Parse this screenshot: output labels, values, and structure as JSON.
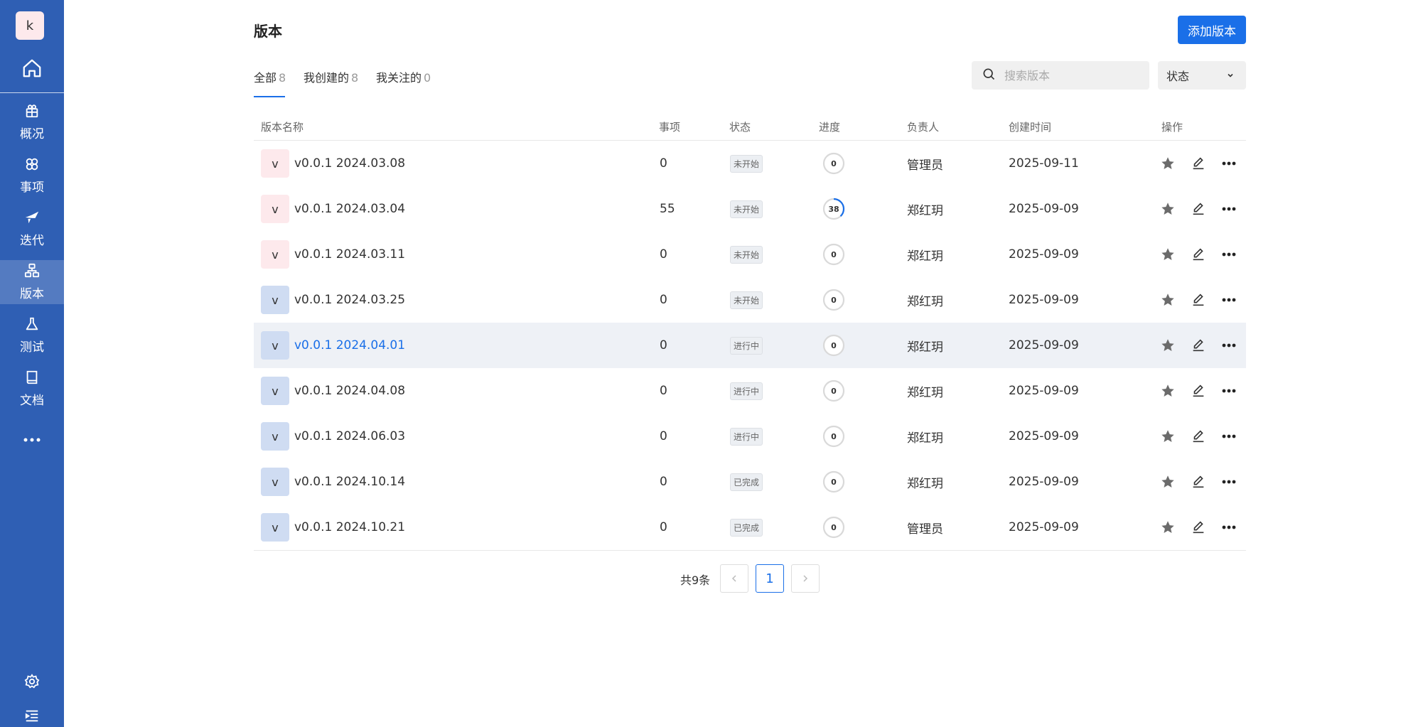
{
  "sidebar": {
    "avatar_letter": "k",
    "nav": [
      {
        "label": "概况",
        "icon": "overview-icon"
      },
      {
        "label": "事项",
        "icon": "items-icon"
      },
      {
        "label": "迭代",
        "icon": "iteration-icon"
      },
      {
        "label": "版本",
        "icon": "version-icon"
      },
      {
        "label": "测试",
        "icon": "test-icon"
      },
      {
        "label": "文档",
        "icon": "docs-icon"
      }
    ],
    "active": "版本"
  },
  "header": {
    "title": "版本",
    "add_button": "添加版本"
  },
  "tabs": [
    {
      "label": "全部",
      "count": "8"
    },
    {
      "label": "我创建的",
      "count": "8"
    },
    {
      "label": "我关注的",
      "count": "0"
    }
  ],
  "search": {
    "placeholder": "搜索版本"
  },
  "status_filter": {
    "label": "状态"
  },
  "table": {
    "columns": [
      "版本名称",
      "事项",
      "状态",
      "进度",
      "负责人",
      "创建时间",
      "操作"
    ],
    "rows": [
      {
        "badge": "v",
        "name": "v0.0.1 2024.03.08",
        "items": "0",
        "status": "未开始",
        "progress": "0",
        "owner": "管理员",
        "created": "2025-09-11"
      },
      {
        "badge": "v",
        "name": "v0.0.1 2024.03.04",
        "items": "55",
        "status": "未开始",
        "progress": "38",
        "owner": "郑红玥",
        "created": "2025-09-09"
      },
      {
        "badge": "v",
        "name": "v0.0.1 2024.03.11",
        "items": "0",
        "status": "未开始",
        "progress": "0",
        "owner": "郑红玥",
        "created": "2025-09-09"
      },
      {
        "badge": "v",
        "name": "v0.0.1 2024.03.25",
        "items": "0",
        "status": "未开始",
        "progress": "0",
        "owner": "郑红玥",
        "created": "2025-09-09"
      },
      {
        "badge": "v",
        "name": "v0.0.1 2024.04.01",
        "items": "0",
        "status": "进行中",
        "progress": "0",
        "owner": "郑红玥",
        "created": "2025-09-09"
      },
      {
        "badge": "v",
        "name": "v0.0.1 2024.04.08",
        "items": "0",
        "status": "进行中",
        "progress": "0",
        "owner": "郑红玥",
        "created": "2025-09-09"
      },
      {
        "badge": "v",
        "name": "v0.0.1 2024.06.03",
        "items": "0",
        "status": "进行中",
        "progress": "0",
        "owner": "郑红玥",
        "created": "2025-09-09"
      },
      {
        "badge": "v",
        "name": "v0.0.1 2024.10.14",
        "items": "0",
        "status": "已完成",
        "progress": "0",
        "owner": "郑红玥",
        "created": "2025-09-09"
      },
      {
        "badge": "v",
        "name": "v0.0.1 2024.10.21",
        "items": "0",
        "status": "已完成",
        "progress": "0",
        "owner": "管理员",
        "created": "2025-09-09"
      }
    ]
  },
  "pagination": {
    "total": "共9条",
    "current": "1"
  },
  "colors": {
    "sidebar": "#2f5fb4",
    "accent": "#1a6fe8",
    "badge_pink": "#fde9ec",
    "badge_blue": "#cfdcf2",
    "row_hover": "#eef1f6"
  }
}
